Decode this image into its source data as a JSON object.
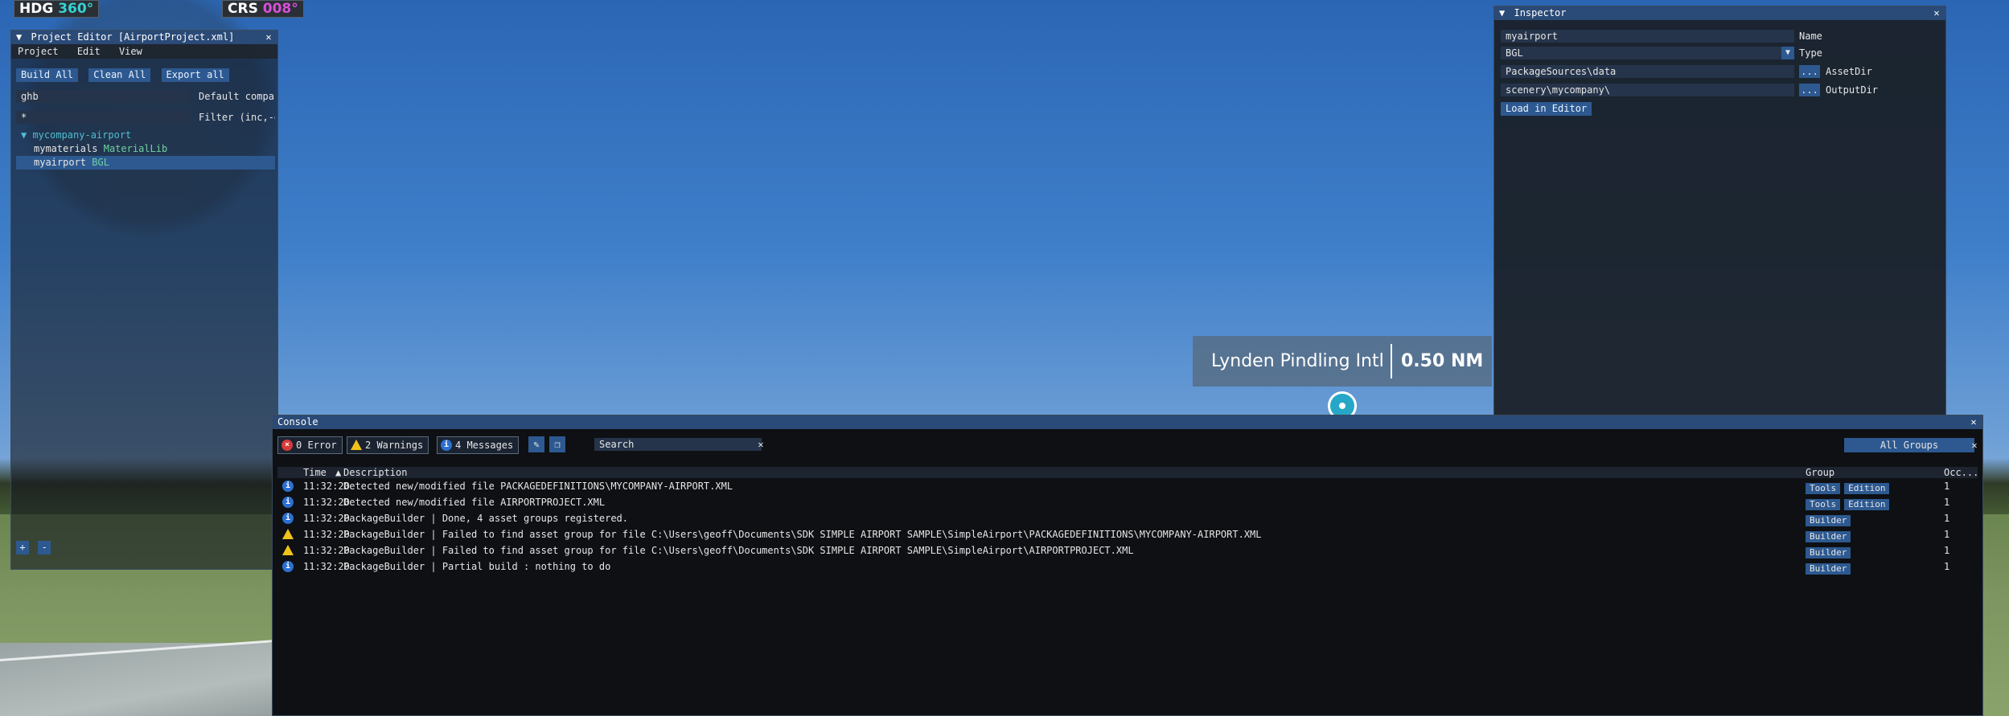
{
  "hud": {
    "hdg_label": "HDG",
    "hdg_value": "360°",
    "crs_label": "CRS",
    "crs_value": "008°"
  },
  "project_editor": {
    "title": "Project Editor [AirportProject.xml]",
    "menu": [
      "Project",
      "Edit",
      "View"
    ],
    "toolbar": {
      "build_all": "Build All",
      "clean_all": "Clean All",
      "export_all": "Export all"
    },
    "company_value": "ghb",
    "company_label": "Default company",
    "filter_value": "*",
    "filter_label": "Filter (inc,-exc)",
    "tree": {
      "root": "mycompany-airport",
      "children": [
        {
          "name": "mymaterials",
          "type": "MaterialLib",
          "selected": false
        },
        {
          "name": "myairport",
          "type": "BGL",
          "selected": true
        }
      ]
    },
    "bottom": {
      "add": "+",
      "remove": "-"
    }
  },
  "inspector": {
    "title": "Inspector",
    "name_value": "myairport",
    "name_label": "Name",
    "type_value": "BGL",
    "type_label": "Type",
    "assetdir_value": "PackageSources\\data",
    "assetdir_label": "AssetDir",
    "outputdir_value": "scenery\\mycompany\\",
    "outputdir_label": "OutputDir",
    "browse_label": "...",
    "load_button": "Load in Editor"
  },
  "airport": {
    "name": "Lynden Pindling Intl",
    "distance": "0.50 NM"
  },
  "console": {
    "title": "Console",
    "errors": "0 Error",
    "warnings": "2 Warnings",
    "messages": "4 Messages",
    "search_placeholder": "Search",
    "groups": "All Groups",
    "columns": {
      "time": "Time",
      "description": "Description",
      "group": "Group",
      "occ": "Occ..."
    },
    "rows": [
      {
        "severity": "info",
        "time": "11:32:20",
        "desc": "Detected new/modified file PACKAGEDEFINITIONS\\MYCOMPANY-AIRPORT.XML",
        "tags": [
          "Tools",
          "Edition"
        ],
        "occ": "1"
      },
      {
        "severity": "info",
        "time": "11:32:20",
        "desc": "Detected new/modified file AIRPORTPROJECT.XML",
        "tags": [
          "Tools",
          "Edition"
        ],
        "occ": "1"
      },
      {
        "severity": "info",
        "time": "11:32:20",
        "desc": "PackageBuilder | Done, 4 asset groups registered.",
        "tags": [
          "Builder"
        ],
        "occ": "1"
      },
      {
        "severity": "warn",
        "time": "11:32:20",
        "desc": "PackageBuilder | Failed to find asset group for file C:\\Users\\geoff\\Documents\\SDK SIMPLE AIRPORT SAMPLE\\SimpleAirport\\PACKAGEDEFINITIONS\\MYCOMPANY-AIRPORT.XML",
        "tags": [
          "Builder"
        ],
        "occ": "1"
      },
      {
        "severity": "warn",
        "time": "11:32:20",
        "desc": "PackageBuilder | Failed to find asset group for file C:\\Users\\geoff\\Documents\\SDK SIMPLE AIRPORT SAMPLE\\SimpleAirport\\AIRPORTPROJECT.XML",
        "tags": [
          "Builder"
        ],
        "occ": "1"
      },
      {
        "severity": "info",
        "time": "11:32:20",
        "desc": "PackageBuilder | Partial build : nothing to do",
        "tags": [
          "Builder"
        ],
        "occ": "1"
      }
    ]
  }
}
